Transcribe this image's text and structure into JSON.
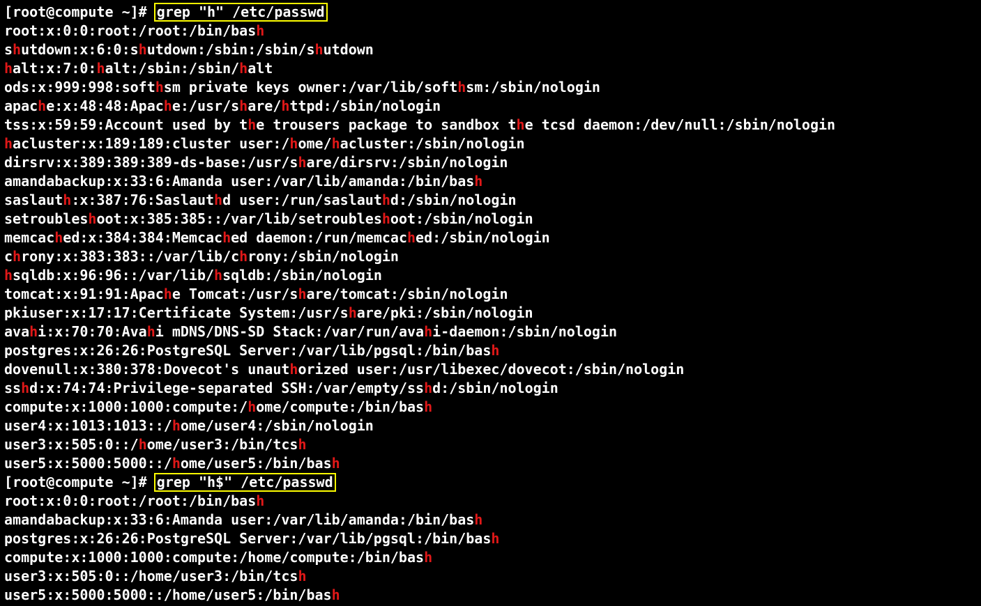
{
  "prompt_user": "root",
  "prompt_host": "compute",
  "prompt_cwd": "~",
  "command1": "grep \"h\" /etc/passwd",
  "command2": "grep \"h$\" /etc/passwd",
  "command2_output_text": "root:x:0:0:root:/root:/bin/bash\namandabackup:x:33:6:Amanda user:/var/lib/amanda:/bin/bash\npostgres:x:26:26:PostgreSQL Server:/var/lib/pgsql:/bin/bash\ncompute:x:1000:1000:compute:/home/compute:/bin/bash\nuser3:x:505:0::/home/user3:/bin/tcsh\nuser5:x:5000:5000::/home/user5:/bin/bash",
  "output1": [
    [
      [
        "root:x:0:0:root:/root:/bin/bas",
        0
      ],
      [
        "h",
        1
      ]
    ],
    [
      [
        "s",
        0
      ],
      [
        "h",
        1
      ],
      [
        "utdown:x:6:0:s",
        0
      ],
      [
        "h",
        1
      ],
      [
        "utdown:/sbin:/sbin/s",
        0
      ],
      [
        "h",
        1
      ],
      [
        "utdown",
        0
      ]
    ],
    [
      [
        "h",
        1
      ],
      [
        "alt:x:7:0:",
        0
      ],
      [
        "h",
        1
      ],
      [
        "alt:/sbin:/sbin/",
        0
      ],
      [
        "h",
        1
      ],
      [
        "alt",
        0
      ]
    ],
    [
      [
        "ods:x:999:998:soft",
        0
      ],
      [
        "h",
        1
      ],
      [
        "sm private keys owner:/var/lib/soft",
        0
      ],
      [
        "h",
        1
      ],
      [
        "sm:/sbin/nologin",
        0
      ]
    ],
    [
      [
        "apac",
        0
      ],
      [
        "h",
        1
      ],
      [
        "e:x:48:48:Apac",
        0
      ],
      [
        "h",
        1
      ],
      [
        "e:/usr/s",
        0
      ],
      [
        "h",
        1
      ],
      [
        "are/",
        0
      ],
      [
        "h",
        1
      ],
      [
        "ttpd:/sbin/nologin",
        0
      ]
    ],
    [
      [
        "tss:x:59:59:Account used by t",
        0
      ],
      [
        "h",
        1
      ],
      [
        "e trousers package to sandbox t",
        0
      ],
      [
        "h",
        1
      ],
      [
        "e tcsd daemon:/dev/null:/sbin/nologin",
        0
      ]
    ],
    [
      [
        "h",
        1
      ],
      [
        "acluster:x:189:189:cluster user:/",
        0
      ],
      [
        "h",
        1
      ],
      [
        "ome/",
        0
      ],
      [
        "h",
        1
      ],
      [
        "acluster:/sbin/nologin",
        0
      ]
    ],
    [
      [
        "dirsrv:x:389:389:389-ds-base:/usr/s",
        0
      ],
      [
        "h",
        1
      ],
      [
        "are/dirsrv:/sbin/nologin",
        0
      ]
    ],
    [
      [
        "amandabackup:x:33:6:Amanda user:/var/lib/amanda:/bin/bas",
        0
      ],
      [
        "h",
        1
      ]
    ],
    [
      [
        "saslaut",
        0
      ],
      [
        "h",
        1
      ],
      [
        ":x:387:76:Saslaut",
        0
      ],
      [
        "h",
        1
      ],
      [
        "d user:/run/saslaut",
        0
      ],
      [
        "h",
        1
      ],
      [
        "d:/sbin/nologin",
        0
      ]
    ],
    [
      [
        "setroubles",
        0
      ],
      [
        "h",
        1
      ],
      [
        "oot:x:385:385::/var/lib/setroubles",
        0
      ],
      [
        "h",
        1
      ],
      [
        "oot:/sbin/nologin",
        0
      ]
    ],
    [
      [
        "memcac",
        0
      ],
      [
        "h",
        1
      ],
      [
        "ed:x:384:384:Memcac",
        0
      ],
      [
        "h",
        1
      ],
      [
        "ed daemon:/run/memcac",
        0
      ],
      [
        "h",
        1
      ],
      [
        "ed:/sbin/nologin",
        0
      ]
    ],
    [
      [
        "c",
        0
      ],
      [
        "h",
        1
      ],
      [
        "rony:x:383:383::/var/lib/c",
        0
      ],
      [
        "h",
        1
      ],
      [
        "rony:/sbin/nologin",
        0
      ]
    ],
    [
      [
        "h",
        1
      ],
      [
        "sqldb:x:96:96::/var/lib/",
        0
      ],
      [
        "h",
        1
      ],
      [
        "sqldb:/sbin/nologin",
        0
      ]
    ],
    [
      [
        "tomcat:x:91:91:Apac",
        0
      ],
      [
        "h",
        1
      ],
      [
        "e Tomcat:/usr/s",
        0
      ],
      [
        "h",
        1
      ],
      [
        "are/tomcat:/sbin/nologin",
        0
      ]
    ],
    [
      [
        "pkiuser:x:17:17:Certificate System:/usr/s",
        0
      ],
      [
        "h",
        1
      ],
      [
        "are/pki:/sbin/nologin",
        0
      ]
    ],
    [
      [
        "ava",
        0
      ],
      [
        "h",
        1
      ],
      [
        "i:x:70:70:Ava",
        0
      ],
      [
        "h",
        1
      ],
      [
        "i mDNS/DNS-SD Stack:/var/run/ava",
        0
      ],
      [
        "h",
        1
      ],
      [
        "i-daemon:/sbin/nologin",
        0
      ]
    ],
    [
      [
        "postgres:x:26:26:PostgreSQL Server:/var/lib/pgsql:/bin/bas",
        0
      ],
      [
        "h",
        1
      ]
    ],
    [
      [
        "dovenull:x:380:378:Dovecot's unaut",
        0
      ],
      [
        "h",
        1
      ],
      [
        "orized user:/usr/libexec/dovecot:/sbin/nologin",
        0
      ]
    ],
    [
      [
        "ss",
        0
      ],
      [
        "h",
        1
      ],
      [
        "d:x:74:74:Privilege-separated SSH:/var/empty/ss",
        0
      ],
      [
        "h",
        1
      ],
      [
        "d:/sbin/nologin",
        0
      ]
    ],
    [
      [
        "compute:x:1000:1000:compute:/",
        0
      ],
      [
        "h",
        1
      ],
      [
        "ome/compute:/bin/bas",
        0
      ],
      [
        "h",
        1
      ]
    ],
    [
      [
        "user4:x:1013:1013::/",
        0
      ],
      [
        "h",
        1
      ],
      [
        "ome/user4:/sbin/nologin",
        0
      ]
    ],
    [
      [
        "user3:x:505:0::/",
        0
      ],
      [
        "h",
        1
      ],
      [
        "ome/user3:/bin/tcs",
        0
      ],
      [
        "h",
        1
      ]
    ],
    [
      [
        "user5:x:5000:5000::/",
        0
      ],
      [
        "h",
        1
      ],
      [
        "ome/user5:/bin/bas",
        0
      ],
      [
        "h",
        1
      ]
    ]
  ],
  "output2": [
    [
      [
        "root:x:0:0:root:/root:/bin/bas",
        0
      ],
      [
        "h",
        1
      ]
    ],
    [
      [
        "amandabackup:x:33:6:Amanda user:/var/lib/amanda:/bin/bas",
        0
      ],
      [
        "h",
        1
      ]
    ],
    [
      [
        "postgres:x:26:26:PostgreSQL Server:/var/lib/pgsql:/bin/bas",
        0
      ],
      [
        "h",
        1
      ]
    ],
    [
      [
        "compute:x:1000:1000:compute:/home/compute:/bin/bas",
        0
      ],
      [
        "h",
        1
      ]
    ],
    [
      [
        "user3:x:505:0::/home/user3:/bin/tcs",
        0
      ],
      [
        "h",
        1
      ]
    ],
    [
      [
        "user5:x:5000:5000::/home/user5:/bin/bas",
        0
      ],
      [
        "h",
        1
      ]
    ]
  ]
}
